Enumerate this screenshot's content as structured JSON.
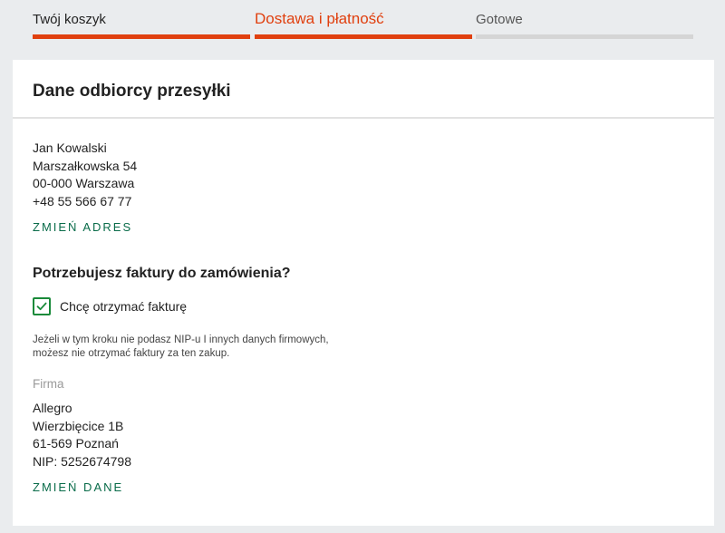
{
  "steps": [
    {
      "label": "Twój koszyk",
      "state": "done"
    },
    {
      "label": "Dostawa i płatność",
      "state": "active"
    },
    {
      "label": "Gotowe",
      "state": "todo"
    }
  ],
  "recipient": {
    "title": "Dane odbiorcy przesyłki",
    "name": "Jan Kowalski",
    "street": "Marszałkowska 54",
    "city": "00-000 Warszawa",
    "phone": "+48 55 566 67 77",
    "change_label": "ZMIEŃ ADRES"
  },
  "invoice": {
    "question": "Potrzebujesz faktury do zamówienia?",
    "checkbox_label": "Chcę otrzymać fakturę",
    "checked": true,
    "note_line1": "Jeżeli w tym kroku nie podasz NIP-u I innych danych firmowych,",
    "note_line2": "możesz nie otrzymać faktury za ten zakup.",
    "firm_label": "Firma",
    "firm_name": "Allegro",
    "firm_street": "Wierzbięcice 1B",
    "firm_city": "61-569 Poznań",
    "firm_nip": "NIP: 5252674798",
    "change_label": "ZMIEŃ DANE"
  },
  "colors": {
    "accent": "#e0400f",
    "link": "#0a6c4a",
    "checkbox": "#1a8a3a"
  }
}
